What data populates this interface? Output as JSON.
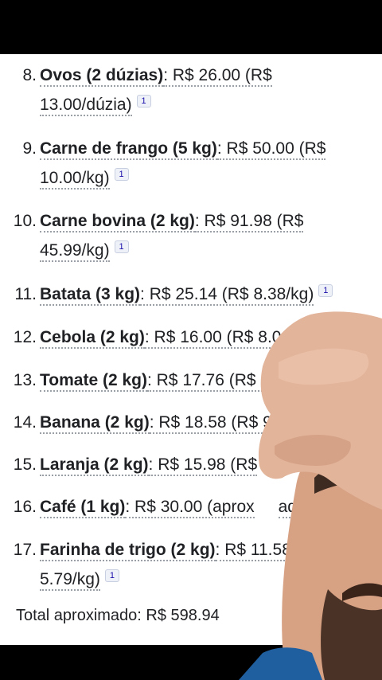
{
  "items": [
    {
      "num": "8.",
      "name": "Ovos (2 dúzias)",
      "line1": ": R$ 26.00 (R$",
      "line2": "13.00/dúzia)",
      "cite": "1"
    },
    {
      "num": "9.",
      "name": "Carne de frango (5 kg)",
      "line1": ": R$ 50.00 (R$",
      "line2": "10.00/kg)",
      "cite": "1"
    },
    {
      "num": "10.",
      "name": "Carne bovina (2 kg)",
      "line1": ": R$ 91.98 (R$",
      "line2": "45.99/kg)",
      "cite": "1"
    },
    {
      "num": "11.",
      "name": "Batata (3 kg)",
      "line1": ": R$ 25.14 (R$ 8.38/kg)",
      "cite": "1"
    },
    {
      "num": "12.",
      "name": "Cebola (2 kg)",
      "line1": ": R$ 16.00 (R$ 8.00/kg)"
    },
    {
      "num": "13.",
      "name": "Tomate (2 kg)",
      "line1": ": R$ 17.76 (R$ 8.8"
    },
    {
      "num": "14.",
      "name": "Banana (2 kg)",
      "line1": ": R$ 18.58 (R$ 9"
    },
    {
      "num": "15.",
      "name": "Laranja (2 kg)",
      "line1": ": R$ 15.98 (R$"
    },
    {
      "num": "16.",
      "name": "Café (1 kg)",
      "line1": ": R$ 30.00 (aprox",
      "line1b": "ad"
    },
    {
      "num": "17.",
      "name": "Farinha de trigo (2 kg)",
      "line1": ": R$ 11.58",
      "line2": "5.79/kg)",
      "cite": "1"
    }
  ],
  "total": "Total aproximado: R$ 598.94",
  "colors": {
    "text": "#202124",
    "citation": "#1a0dab",
    "background": "#ffffff",
    "letterbox": "#000000"
  }
}
